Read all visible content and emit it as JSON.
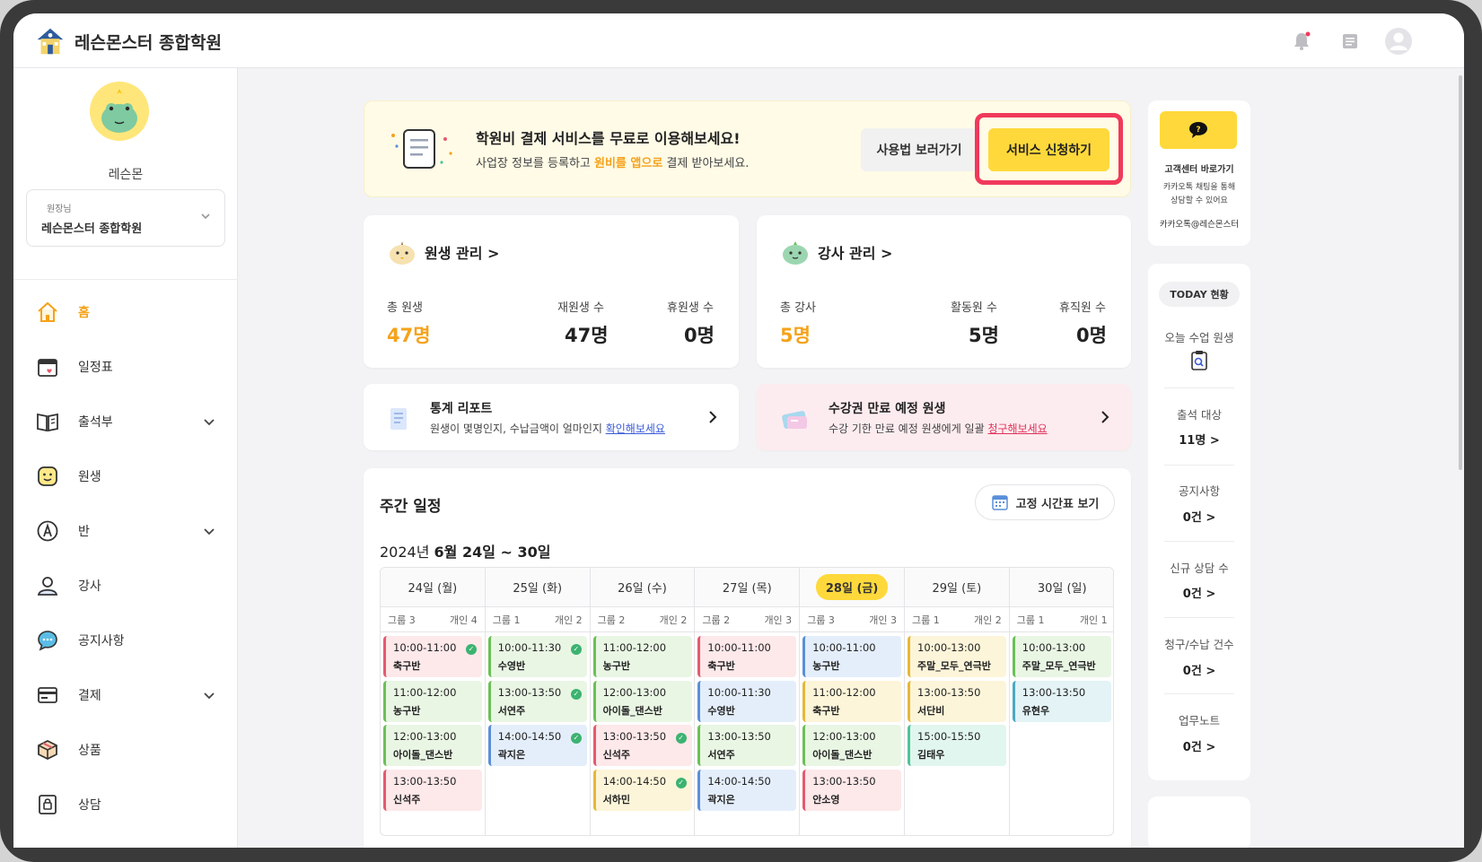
{
  "app": {
    "title": "레슨몬스터 종합학원"
  },
  "sidebar": {
    "profile_name": "레슨몬",
    "role": "원장님",
    "academy": "레슨몬스터 종합학원",
    "items": [
      {
        "label": "홈"
      },
      {
        "label": "일정표"
      },
      {
        "label": "출석부"
      },
      {
        "label": "원생"
      },
      {
        "label": "반"
      },
      {
        "label": "강사"
      },
      {
        "label": "공지사항"
      },
      {
        "label": "결제"
      },
      {
        "label": "상품"
      },
      {
        "label": "상담"
      }
    ]
  },
  "banner": {
    "title": "학원비 결제 서비스를 무료로 이용해보세요!",
    "sub_before": "사업장 정보를 등록하고 ",
    "sub_highlight": "원비를 앱으로",
    "sub_after": " 결제 받아보세요.",
    "guide_button": "사용법 보러가기",
    "apply_button": "서비스 신청하기"
  },
  "students": {
    "title": "원생 관리 >",
    "total_label": "총 원생",
    "total": "47명",
    "enrolled_label": "재원생 수",
    "enrolled": "47명",
    "paused_label": "휴원생 수",
    "paused": "0명"
  },
  "teachers": {
    "title": "강사 관리 >",
    "total_label": "총 강사",
    "total": "5명",
    "active_label": "활동원 수",
    "active": "5명",
    "leave_label": "휴직원 수",
    "leave": "0명"
  },
  "report": {
    "title": "통계 리포트",
    "sub": "원생이 몇명인지, 수납금액이 얼마인지 ",
    "link": "확인해보세요"
  },
  "expiry": {
    "title": "수강권 만료 예정 원생",
    "sub": "수강 기한 만료 예정 원생에게 일괄 ",
    "link": "청구해보세요"
  },
  "weekly": {
    "title": "주간 일정",
    "fixed_button": "고정 시간표 보기",
    "range_prefix": "2024년 ",
    "range_bold": "6월 24일 ~ 30일",
    "days": [
      {
        "label": "24일 (월)",
        "group": "그룹 3",
        "personal": "개인 4",
        "today": false
      },
      {
        "label": "25일 (화)",
        "group": "그룹 1",
        "personal": "개인 2",
        "today": false
      },
      {
        "label": "26일 (수)",
        "group": "그룹 2",
        "personal": "개인 2",
        "today": false
      },
      {
        "label": "27일 (목)",
        "group": "그룹 2",
        "personal": "개인 3",
        "today": false
      },
      {
        "label": "28일 (금)",
        "group": "그룹 3",
        "personal": "개인 3",
        "today": true
      },
      {
        "label": "29일 (토)",
        "group": "그룹 1",
        "personal": "개인 2",
        "today": false
      },
      {
        "label": "30일 (일)",
        "group": "그룹 1",
        "personal": "개인 1",
        "today": false
      }
    ],
    "events": [
      [
        {
          "time": "10:00-11:00",
          "name": "축구반",
          "color": "pink",
          "done": true
        },
        {
          "time": "11:00-12:00",
          "name": "농구반",
          "color": "green",
          "done": false
        },
        {
          "time": "12:00-13:00",
          "name": "아이돌_댄스반",
          "color": "green",
          "done": false
        },
        {
          "time": "13:00-13:50",
          "name": "신석주",
          "color": "pink",
          "done": false
        }
      ],
      [
        {
          "time": "10:00-11:30",
          "name": "수영반",
          "color": "green",
          "done": true
        },
        {
          "time": "13:00-13:50",
          "name": "서연주",
          "color": "green",
          "done": true
        },
        {
          "time": "14:00-14:50",
          "name": "곽지은",
          "color": "blue",
          "done": true
        }
      ],
      [
        {
          "time": "11:00-12:00",
          "name": "농구반",
          "color": "green",
          "done": false
        },
        {
          "time": "12:00-13:00",
          "name": "아이돌_댄스반",
          "color": "green",
          "done": false
        },
        {
          "time": "13:00-13:50",
          "name": "신석주",
          "color": "pink",
          "done": true
        },
        {
          "time": "14:00-14:50",
          "name": "서하민",
          "color": "yellow",
          "done": true
        }
      ],
      [
        {
          "time": "10:00-11:00",
          "name": "축구반",
          "color": "pink",
          "done": false
        },
        {
          "time": "10:00-11:30",
          "name": "수영반",
          "color": "blue",
          "done": false
        },
        {
          "time": "13:00-13:50",
          "name": "서연주",
          "color": "green",
          "done": false
        },
        {
          "time": "14:00-14:50",
          "name": "곽지은",
          "color": "blue",
          "done": false
        }
      ],
      [
        {
          "time": "10:00-11:00",
          "name": "농구반",
          "color": "blue",
          "done": false
        },
        {
          "time": "11:00-12:00",
          "name": "축구반",
          "color": "yellow",
          "done": false
        },
        {
          "time": "12:00-13:00",
          "name": "아이돌_댄스반",
          "color": "green",
          "done": false
        },
        {
          "time": "13:00-13:50",
          "name": "안소영",
          "color": "pink",
          "done": false
        }
      ],
      [
        {
          "time": "10:00-13:00",
          "name": "주말_모두_연극반",
          "color": "yellow",
          "done": false
        },
        {
          "time": "13:00-13:50",
          "name": "서단비",
          "color": "yellow",
          "done": false
        },
        {
          "time": "15:00-15:50",
          "name": "김태우",
          "color": "mint",
          "done": false
        }
      ],
      [
        {
          "time": "10:00-13:00",
          "name": "주말_모두_연극반",
          "color": "green",
          "done": false
        },
        {
          "time": "13:00-13:50",
          "name": "유현우",
          "color": "teal",
          "done": false
        }
      ]
    ]
  },
  "help": {
    "title": "고객센터 바로가기",
    "sub1": "카카오톡 채팅을 통해",
    "sub2": "상담할 수 있어요",
    "id": "카카오톡@레슨몬스터"
  },
  "today": {
    "badge": "TODAY 현황",
    "class_label": "오늘 수업 원생",
    "rows": [
      {
        "label": "출석 대상",
        "value": "11명 >"
      },
      {
        "label": "공지사항",
        "value": "0건 >"
      },
      {
        "label": "신규 상담 수",
        "value": "0건 >"
      },
      {
        "label": "청구/수납 건수",
        "value": "0건 >"
      },
      {
        "label": "업무노트",
        "value": "0건 >"
      }
    ]
  }
}
